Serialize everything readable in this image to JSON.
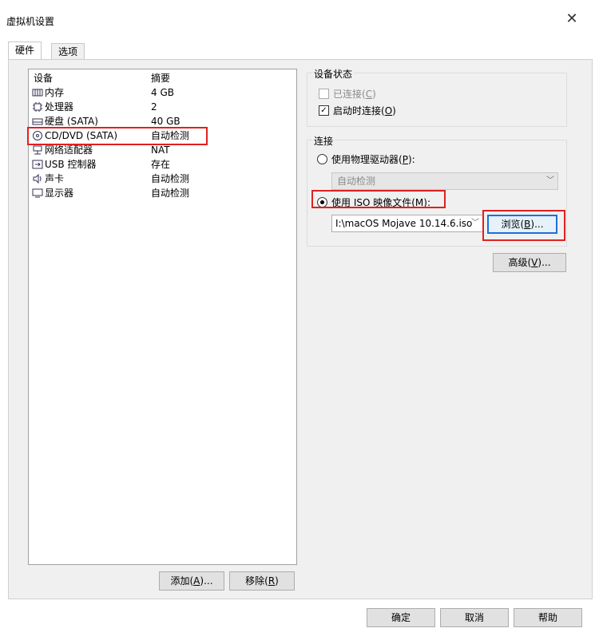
{
  "window": {
    "title": "虚拟机设置"
  },
  "tabs": [
    {
      "label": "硬件"
    },
    {
      "label": "选项"
    }
  ],
  "device_list": {
    "col_device": "设备",
    "col_summary": "摘要",
    "items": [
      {
        "name": "内存",
        "summary": "4 GB",
        "icon": "memory-icon"
      },
      {
        "name": "处理器",
        "summary": "2",
        "icon": "cpu-icon"
      },
      {
        "name": "硬盘 (SATA)",
        "summary": "40 GB",
        "icon": "harddisk-icon"
      },
      {
        "name": "CD/DVD (SATA)",
        "summary": "自动检测",
        "icon": "cd-dvd-icon",
        "selected": true
      },
      {
        "name": "网络适配器",
        "summary": "NAT",
        "icon": "network-icon"
      },
      {
        "name": "USB 控制器",
        "summary": "存在",
        "icon": "usb-icon"
      },
      {
        "name": "声卡",
        "summary": "自动检测",
        "icon": "sound-icon"
      },
      {
        "name": "显示器",
        "summary": "自动检测",
        "icon": "display-icon"
      }
    ],
    "add_button": {
      "text": "添加",
      "key": "A",
      "suffix": "..."
    },
    "remove_button": {
      "text": "移除",
      "key": "R"
    }
  },
  "device_status": {
    "title": "设备状态",
    "connected": {
      "text": "已连接",
      "key": "C",
      "checked": false,
      "enabled": false
    },
    "connect_at_power_on": {
      "text": "启动时连接",
      "key": "O",
      "checked": true
    }
  },
  "connection": {
    "title": "连接",
    "physical": {
      "text": "使用物理驱动器",
      "key": "P",
      "suffix": ":"
    },
    "physical_value": "自动检测",
    "iso": {
      "text": "使用 ISO 映像文件",
      "key": "M",
      "suffix": ":",
      "selected": true
    },
    "iso_path": "I:\\macOS Mojave 10.14.6.iso",
    "browse": {
      "text": "浏览",
      "key": "B",
      "suffix": "..."
    }
  },
  "advanced_button": {
    "text": "高级",
    "key": "V",
    "suffix": "..."
  },
  "footer": {
    "ok": "确定",
    "cancel": "取消",
    "help": "帮助"
  },
  "colors": {
    "highlight_box": "#e02020",
    "focus_border": "#1e6fd9"
  }
}
